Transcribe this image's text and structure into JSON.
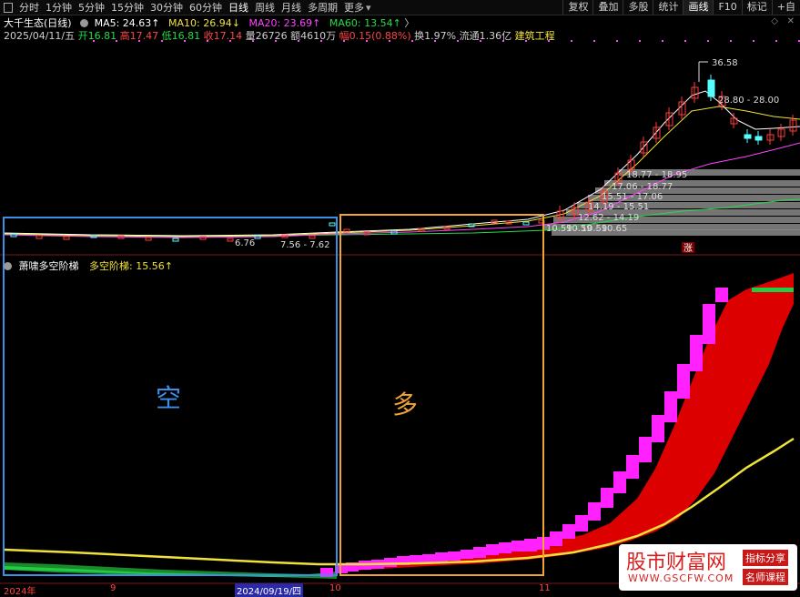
{
  "toolbar": {
    "periods": [
      "分时",
      "1分钟",
      "5分钟",
      "15分钟",
      "30分钟",
      "60分钟",
      "日线",
      "周线",
      "月线",
      "多周期",
      "更多"
    ],
    "right": [
      "复权",
      "叠加",
      "多股",
      "统计",
      "画线",
      "F10",
      "标记",
      "+自"
    ]
  },
  "main_header": {
    "stock": "大千生态(日线)",
    "ma5": "MA5: 24.63↑",
    "ma10": "MA10: 26.94↓",
    "ma20": "MA20: 23.69↑",
    "ma60": "MA60: 13.54↑"
  },
  "quote": {
    "date": "2025/04/11/五",
    "open": "开16.81",
    "high": "高17.47",
    "low": "低16.81",
    "close": "收17.14",
    "volume": "量26726",
    "amount": "额4610万",
    "change": "幅0.15(0.88%)",
    "turnover": "换1.97%",
    "float": "流通1.36亿",
    "industry": "建筑工程"
  },
  "price_labels": {
    "high_price": "36.58",
    "range_top": "28.80 - 28.00",
    "low_left": "6.76",
    "range_bottom": "7.56 - 7.62",
    "chip_1": "18.77 - 18.95",
    "chip_2": "17.06 - 18.77",
    "chip_3": "15.51 - 17.06",
    "chip_4": "14.19 - 15.51",
    "chip_5": "12.62 - 14.19",
    "chip_6": "10.59 - 10.59",
    "chip_7": "10.59 - 10.65",
    "zhang_badge": "涨"
  },
  "indicator_header": {
    "name": "萧啸多空阶梯",
    "value": "多空阶梯: 15.56↑"
  },
  "annotations": {
    "bear": "空",
    "bull": "多"
  },
  "date_axis": [
    "2024年",
    "9",
    "2024/09/19/四",
    "10",
    "11"
  ],
  "watermark": {
    "brand": "股市财富网",
    "url": "WWW.GSCFW.COM",
    "tag1": "指标分享",
    "tag2": "名师课程"
  },
  "colors": {
    "up_candle": "#ff3c3c",
    "down_candle": "#55ffff",
    "ma5": "#ffffff",
    "ma10": "#f0e23a",
    "ma20": "#ff44ff",
    "ma60": "#22dd44",
    "bear_box": "#3a8fe8",
    "bull_box": "#f0a530"
  }
}
